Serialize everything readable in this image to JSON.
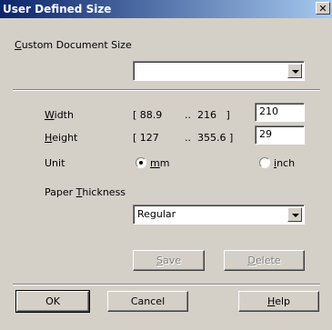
{
  "window": {
    "title": "User Defined Size"
  },
  "custom_size": {
    "label": "Custom Document Size",
    "value": ""
  },
  "width": {
    "label": "Width",
    "range_open": "[ 88.9",
    "dots": "..",
    "range_close": "216   ]",
    "value": "210"
  },
  "height": {
    "label": "Height",
    "range_open": "[ 127",
    "dots": "..",
    "range_close": "355.6 ]",
    "value": "29"
  },
  "unit": {
    "label": "Unit",
    "options": [
      "mm",
      "inch"
    ],
    "selected": "mm"
  },
  "thickness": {
    "label": "Paper Thickness",
    "value": "Regular"
  },
  "buttons": {
    "save": "Save",
    "delete": "Delete",
    "ok": "OK",
    "cancel": "Cancel",
    "help": "Help"
  },
  "icons": {
    "close": "close-icon",
    "dropdown": "chevron-down-icon"
  }
}
